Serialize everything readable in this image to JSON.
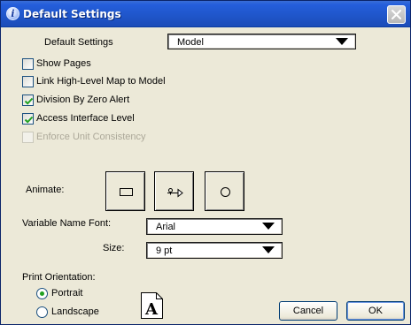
{
  "window": {
    "title": "Default Settings",
    "title_icon": "info-icon",
    "close_icon": "close-icon"
  },
  "default_settings": {
    "label": "Default Settings",
    "selected": "Model"
  },
  "checkboxes": [
    {
      "label": "Show Pages",
      "checked": false,
      "enabled": true
    },
    {
      "label": "Link High-Level Map to Model",
      "checked": false,
      "enabled": true
    },
    {
      "label": "Division By Zero Alert",
      "checked": true,
      "enabled": true
    },
    {
      "label": "Access Interface Level",
      "checked": true,
      "enabled": true
    },
    {
      "label": "Enforce Unit Consistency",
      "checked": false,
      "enabled": false
    }
  ],
  "animate": {
    "label": "Animate:",
    "buttons": [
      "rectangle-icon",
      "flow-icon",
      "circle-icon"
    ]
  },
  "variable_font": {
    "label": "Variable Name Font:",
    "selected": "Arial"
  },
  "size": {
    "label": "Size:",
    "selected": "9 pt"
  },
  "print_orientation": {
    "label": "Print Orientation:",
    "options": [
      {
        "label": "Portrait",
        "selected": true
      },
      {
        "label": "Landscape",
        "selected": false
      }
    ],
    "preview_letter": "A"
  },
  "buttons": {
    "cancel": "Cancel",
    "ok": "OK"
  },
  "colors": {
    "titlebar": "#245edb",
    "dialog_bg": "#ece9d8",
    "checkmark": "#21a121"
  }
}
